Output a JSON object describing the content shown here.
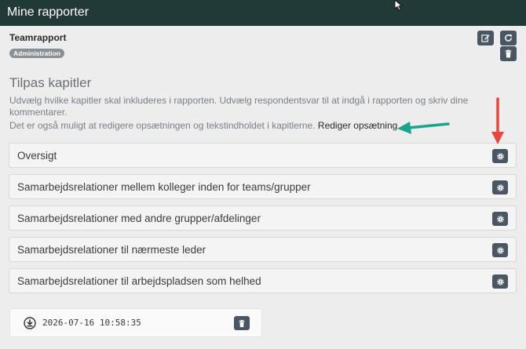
{
  "header": {
    "title": "Mine rapporter"
  },
  "report": {
    "name": "Teamrapport",
    "badge": "Administration"
  },
  "customize": {
    "title": "Tilpas kapitler",
    "description": "Udvælg hvilke kapitler skal inkluderes i rapporten. Udvælg respondentsvar til at indgå i rapporten og skriv dine kommentarer.",
    "note": "Det er også muligt at redigere opsætningen og tekstindholdet i kapitlerne.",
    "edit_link": "Rediger opsætning"
  },
  "chapters": [
    {
      "label": "Oversigt"
    },
    {
      "label": "Samarbejdsrelationer mellem kolleger inden for teams/grupper"
    },
    {
      "label": "Samarbejdsrelationer med andre grupper/afdelinger"
    },
    {
      "label": "Samarbejdsrelationer til nærmeste leder"
    },
    {
      "label": "Samarbejdsrelationer til arbejdspladsen som helhed"
    }
  ],
  "export": {
    "timestamp": "2026-07-16 10:58:35"
  },
  "colors": {
    "header_bg": "#213a37",
    "button_bg": "#4a5763",
    "annotation_red": "#e8473f",
    "annotation_green": "#1aa58a"
  },
  "icons": [
    "edit-icon",
    "refresh-icon",
    "trash-icon",
    "gear-icon",
    "download-icon",
    "mouse-cursor-icon"
  ]
}
